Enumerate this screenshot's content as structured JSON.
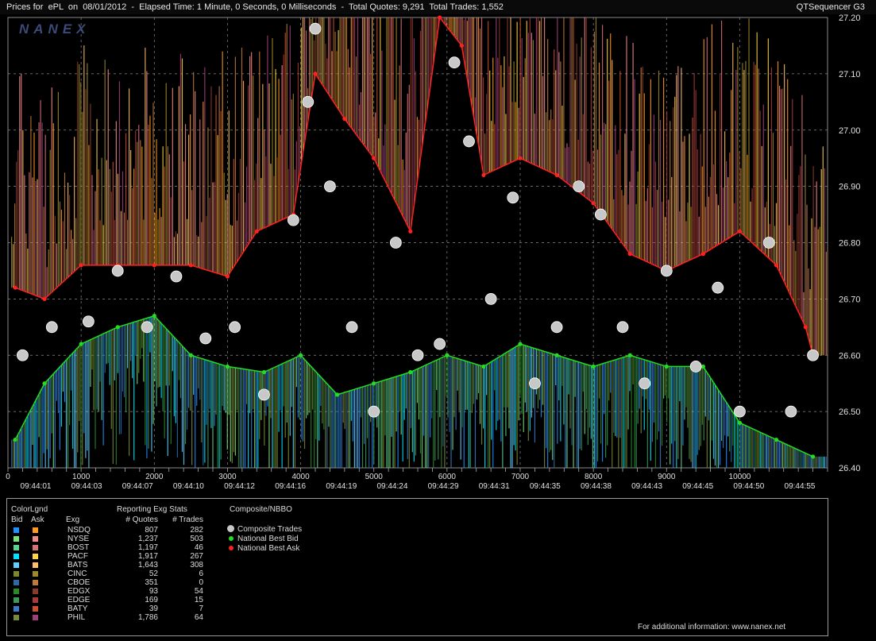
{
  "header": {
    "title": "Prices for  ePL  on  08/01/2012  -  Elapsed Time: 1 Minute, 0 Seconds, 0 Milliseconds  -  Total Quotes: 9,291  Total Trades: 1,552",
    "app_name": "QTSequencer G3"
  },
  "watermark": "NANEX",
  "colors": {
    "background": "#000000",
    "composite_trade": "#c8c8c8",
    "best_bid": "#22dd22",
    "best_ask": "#ff2020"
  },
  "chart_data": {
    "type": "scatter",
    "y_ticks": [
      "27.20",
      "27.10",
      "27.00",
      "26.90",
      "26.80",
      "26.70",
      "26.60",
      "26.50",
      "26.40"
    ],
    "ylim": [
      26.4,
      27.2
    ],
    "x_ticks": [
      "0",
      "1000",
      "2000",
      "3000",
      "4000",
      "5000",
      "6000",
      "7000",
      "8000",
      "9000",
      "10000"
    ],
    "xlim": [
      0,
      11200
    ],
    "time_labels": [
      "09:44:01",
      "09:44:03",
      "09:44:07",
      "09:44:10",
      "09:44:12",
      "09:44:16",
      "09:44:19",
      "09:44:24",
      "09:44:29",
      "09:44:31",
      "09:44:35",
      "09:44:38",
      "09:44:43",
      "09:44:45",
      "09:44:50",
      "09:44:55"
    ],
    "grid": true,
    "series": [
      {
        "name": "Composite Trades",
        "color": "#c8c8c8",
        "points": [
          [
            200,
            26.6
          ],
          [
            600,
            26.65
          ],
          [
            1100,
            26.66
          ],
          [
            1500,
            26.75
          ],
          [
            1900,
            26.65
          ],
          [
            2300,
            26.74
          ],
          [
            2700,
            26.63
          ],
          [
            3100,
            26.65
          ],
          [
            3500,
            26.53
          ],
          [
            3900,
            26.84
          ],
          [
            4100,
            27.05
          ],
          [
            4200,
            27.18
          ],
          [
            4400,
            26.9
          ],
          [
            4700,
            26.65
          ],
          [
            5000,
            26.5
          ],
          [
            5300,
            26.8
          ],
          [
            5600,
            26.6
          ],
          [
            5900,
            26.62
          ],
          [
            6100,
            27.12
          ],
          [
            6300,
            26.98
          ],
          [
            6600,
            26.7
          ],
          [
            6900,
            26.88
          ],
          [
            7200,
            26.55
          ],
          [
            7500,
            26.65
          ],
          [
            7800,
            26.9
          ],
          [
            8100,
            26.85
          ],
          [
            8400,
            26.65
          ],
          [
            8700,
            26.55
          ],
          [
            9000,
            26.75
          ],
          [
            9400,
            26.58
          ],
          [
            9700,
            26.72
          ],
          [
            10000,
            26.5
          ],
          [
            10400,
            26.8
          ],
          [
            10700,
            26.5
          ],
          [
            11000,
            26.6
          ]
        ]
      },
      {
        "name": "National Best Bid",
        "color": "#22dd22",
        "points": [
          [
            100,
            26.45
          ],
          [
            500,
            26.55
          ],
          [
            1000,
            26.62
          ],
          [
            1500,
            26.65
          ],
          [
            2000,
            26.67
          ],
          [
            2500,
            26.6
          ],
          [
            3000,
            26.58
          ],
          [
            3500,
            26.57
          ],
          [
            4000,
            26.6
          ],
          [
            4500,
            26.53
          ],
          [
            5000,
            26.55
          ],
          [
            5500,
            26.57
          ],
          [
            6000,
            26.6
          ],
          [
            6500,
            26.58
          ],
          [
            7000,
            26.62
          ],
          [
            7500,
            26.6
          ],
          [
            8000,
            26.58
          ],
          [
            8500,
            26.6
          ],
          [
            9000,
            26.58
          ],
          [
            9500,
            26.58
          ],
          [
            10000,
            26.48
          ],
          [
            10500,
            26.45
          ],
          [
            11000,
            26.42
          ]
        ]
      },
      {
        "name": "National Best Ask",
        "color": "#ff2020",
        "points": [
          [
            100,
            26.72
          ],
          [
            500,
            26.7
          ],
          [
            1000,
            26.76
          ],
          [
            1500,
            26.76
          ],
          [
            2000,
            26.76
          ],
          [
            2500,
            26.76
          ],
          [
            3000,
            26.74
          ],
          [
            3400,
            26.82
          ],
          [
            3900,
            26.85
          ],
          [
            4200,
            27.1
          ],
          [
            4600,
            27.02
          ],
          [
            5000,
            26.95
          ],
          [
            5500,
            26.82
          ],
          [
            5900,
            27.2
          ],
          [
            6200,
            27.15
          ],
          [
            6500,
            26.92
          ],
          [
            7000,
            26.95
          ],
          [
            7500,
            26.92
          ],
          [
            8000,
            26.87
          ],
          [
            8500,
            26.78
          ],
          [
            9000,
            26.75
          ],
          [
            9500,
            26.78
          ],
          [
            10000,
            26.82
          ],
          [
            10500,
            26.76
          ],
          [
            10900,
            26.65
          ],
          [
            11000,
            26.6
          ]
        ]
      }
    ]
  },
  "legend": {
    "color_legend_title": "ColorLgnd",
    "bid_label": "Bid",
    "ask_label": "Ask",
    "stats_title": "Reporting Exg Stats",
    "col_exchange": "Exg",
    "col_quotes": "# Quotes",
    "col_trades": "# Trades",
    "nbbo_title": "Composite/NBBO",
    "nbbo_items": [
      {
        "label": "Composite Trades",
        "color": "#c8c8c8"
      },
      {
        "label": "National Best Bid",
        "color": "#22dd22"
      },
      {
        "label": "National Best Ask",
        "color": "#ff2020"
      }
    ],
    "exchanges": [
      {
        "name": "NSDQ",
        "quotes": "807",
        "trades": "282",
        "bid_color": "#1e90ff",
        "ask_color": "#ff9a1e"
      },
      {
        "name": "NYSE",
        "quotes": "1,237",
        "trades": "503",
        "bid_color": "#7ae07a",
        "ask_color": "#f08a8a"
      },
      {
        "name": "BOST",
        "quotes": "1,197",
        "trades": "46",
        "bid_color": "#5fcf8f",
        "ask_color": "#d8707a"
      },
      {
        "name": "PACF",
        "quotes": "1,917",
        "trades": "267",
        "bid_color": "#00e5ff",
        "ask_color": "#ffd24a"
      },
      {
        "name": "BATS",
        "quotes": "1,643",
        "trades": "308",
        "bid_color": "#5fd0ff",
        "ask_color": "#ffbe6a"
      },
      {
        "name": "CINC",
        "quotes": "52",
        "trades": "6",
        "bid_color": "#7a8a2a",
        "ask_color": "#9a8a2a"
      },
      {
        "name": "CBOE",
        "quotes": "351",
        "trades": "0",
        "bid_color": "#2a6aa8",
        "ask_color": "#c07a3a"
      },
      {
        "name": "EDGX",
        "quotes": "93",
        "trades": "54",
        "bid_color": "#2a8a2a",
        "ask_color": "#8a3a2a"
      },
      {
        "name": "EDGE",
        "quotes": "169",
        "trades": "15",
        "bid_color": "#3a9a5a",
        "ask_color": "#a83a3a"
      },
      {
        "name": "BATY",
        "quotes": "39",
        "trades": "7",
        "bid_color": "#3a7ac8",
        "ask_color": "#c8502a"
      },
      {
        "name": "PHIL",
        "quotes": "1,786",
        "trades": "64",
        "bid_color": "#7a8a3a",
        "ask_color": "#a0407a"
      }
    ],
    "footer": "For additional information: www.nanex.net"
  }
}
